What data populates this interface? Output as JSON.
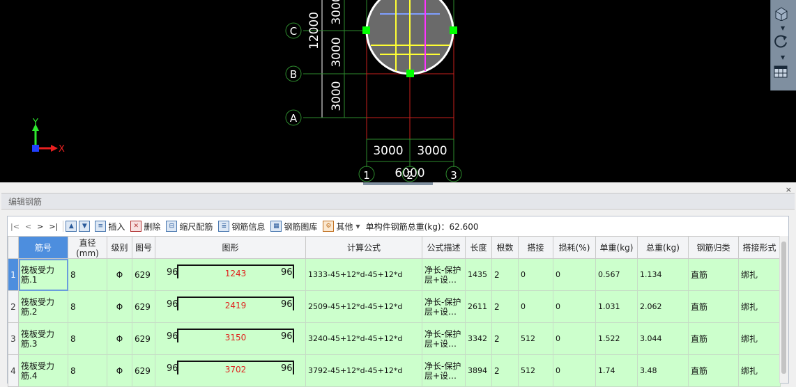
{
  "cad": {
    "axis_rows": [
      "C",
      "B",
      "A"
    ],
    "axis_cols": [
      "1",
      "2",
      "3"
    ],
    "dim_vertical_total": "12000",
    "dim_vertical_segments": [
      "3000",
      "3000",
      "3000"
    ],
    "dim_horizontal_segments": [
      "3000",
      "3000"
    ],
    "dim_horizontal_total": "6000",
    "axis_label_x": "X",
    "axis_label_y": "Y",
    "colors": {
      "grid": "#2e8b2e",
      "red_line": "#c8201c",
      "grip": "#00ff00",
      "circle_fill": "#6a6a6a",
      "yellow": "#ffff33",
      "magenta": "#ff33ff",
      "blue": "#7f9fff"
    }
  },
  "right_tools": {
    "icons": [
      "cube-view-icon",
      "rotate-icon",
      "grid-settings-icon"
    ]
  },
  "panel": {
    "title": "编辑钢筋",
    "close_glyph": "×"
  },
  "toolbar": {
    "nav_first": "|<",
    "nav_prev": "<",
    "nav_next": ">",
    "nav_last": ">|",
    "insert_label": "插入",
    "delete_label": "删除",
    "scale_label": "缩尺配筋",
    "info_label": "钢筋信息",
    "library_label": "钢筋图库",
    "other_label": "其他",
    "total_weight_label": "单构件钢筋总重(kg)：62.600"
  },
  "table": {
    "columns": [
      "筋号",
      "直径(mm)",
      "级别",
      "图号",
      "图形",
      "计算公式",
      "公式描述",
      "长度",
      "根数",
      "搭接",
      "损耗(%)",
      "单重(kg)",
      "总重(kg)",
      "钢筋归类",
      "搭接形式"
    ],
    "rows": [
      {
        "num": "1",
        "name": "筏板受力筋.1",
        "dia": "8",
        "grade": "Φ",
        "fig": "629",
        "left": "96",
        "mid": "1243",
        "right": "96",
        "formula": "1333-45+12*d-45+12*d",
        "desc": "净长-保护层+设…",
        "len": "1435",
        "count": "2",
        "lap": "0",
        "loss": "0",
        "unit_w": "0.567",
        "total_w": "1.134",
        "cls": "直筋",
        "lap_type": "绑扎"
      },
      {
        "num": "2",
        "name": "筏板受力筋.2",
        "dia": "8",
        "grade": "Φ",
        "fig": "629",
        "left": "96",
        "mid": "2419",
        "right": "96",
        "formula": "2509-45+12*d-45+12*d",
        "desc": "净长-保护层+设…",
        "len": "2611",
        "count": "2",
        "lap": "0",
        "loss": "0",
        "unit_w": "1.031",
        "total_w": "2.062",
        "cls": "直筋",
        "lap_type": "绑扎"
      },
      {
        "num": "3",
        "name": "筏板受力筋.3",
        "dia": "8",
        "grade": "Φ",
        "fig": "629",
        "left": "96",
        "mid": "3150",
        "right": "96",
        "formula": "3240-45+12*d-45+12*d",
        "desc": "净长-保护层+设…",
        "len": "3342",
        "count": "2",
        "lap": "512",
        "loss": "0",
        "unit_w": "1.522",
        "total_w": "3.044",
        "cls": "直筋",
        "lap_type": "绑扎"
      },
      {
        "num": "4",
        "name": "筏板受力筋.4",
        "dia": "8",
        "grade": "Φ",
        "fig": "629",
        "left": "96",
        "mid": "3702",
        "right": "96",
        "formula": "3792-45+12*d-45+12*d",
        "desc": "净长-保护层+设…",
        "len": "3894",
        "count": "2",
        "lap": "512",
        "loss": "0",
        "unit_w": "1.74",
        "total_w": "3.48",
        "cls": "直筋",
        "lap_type": "绑扎"
      }
    ]
  }
}
